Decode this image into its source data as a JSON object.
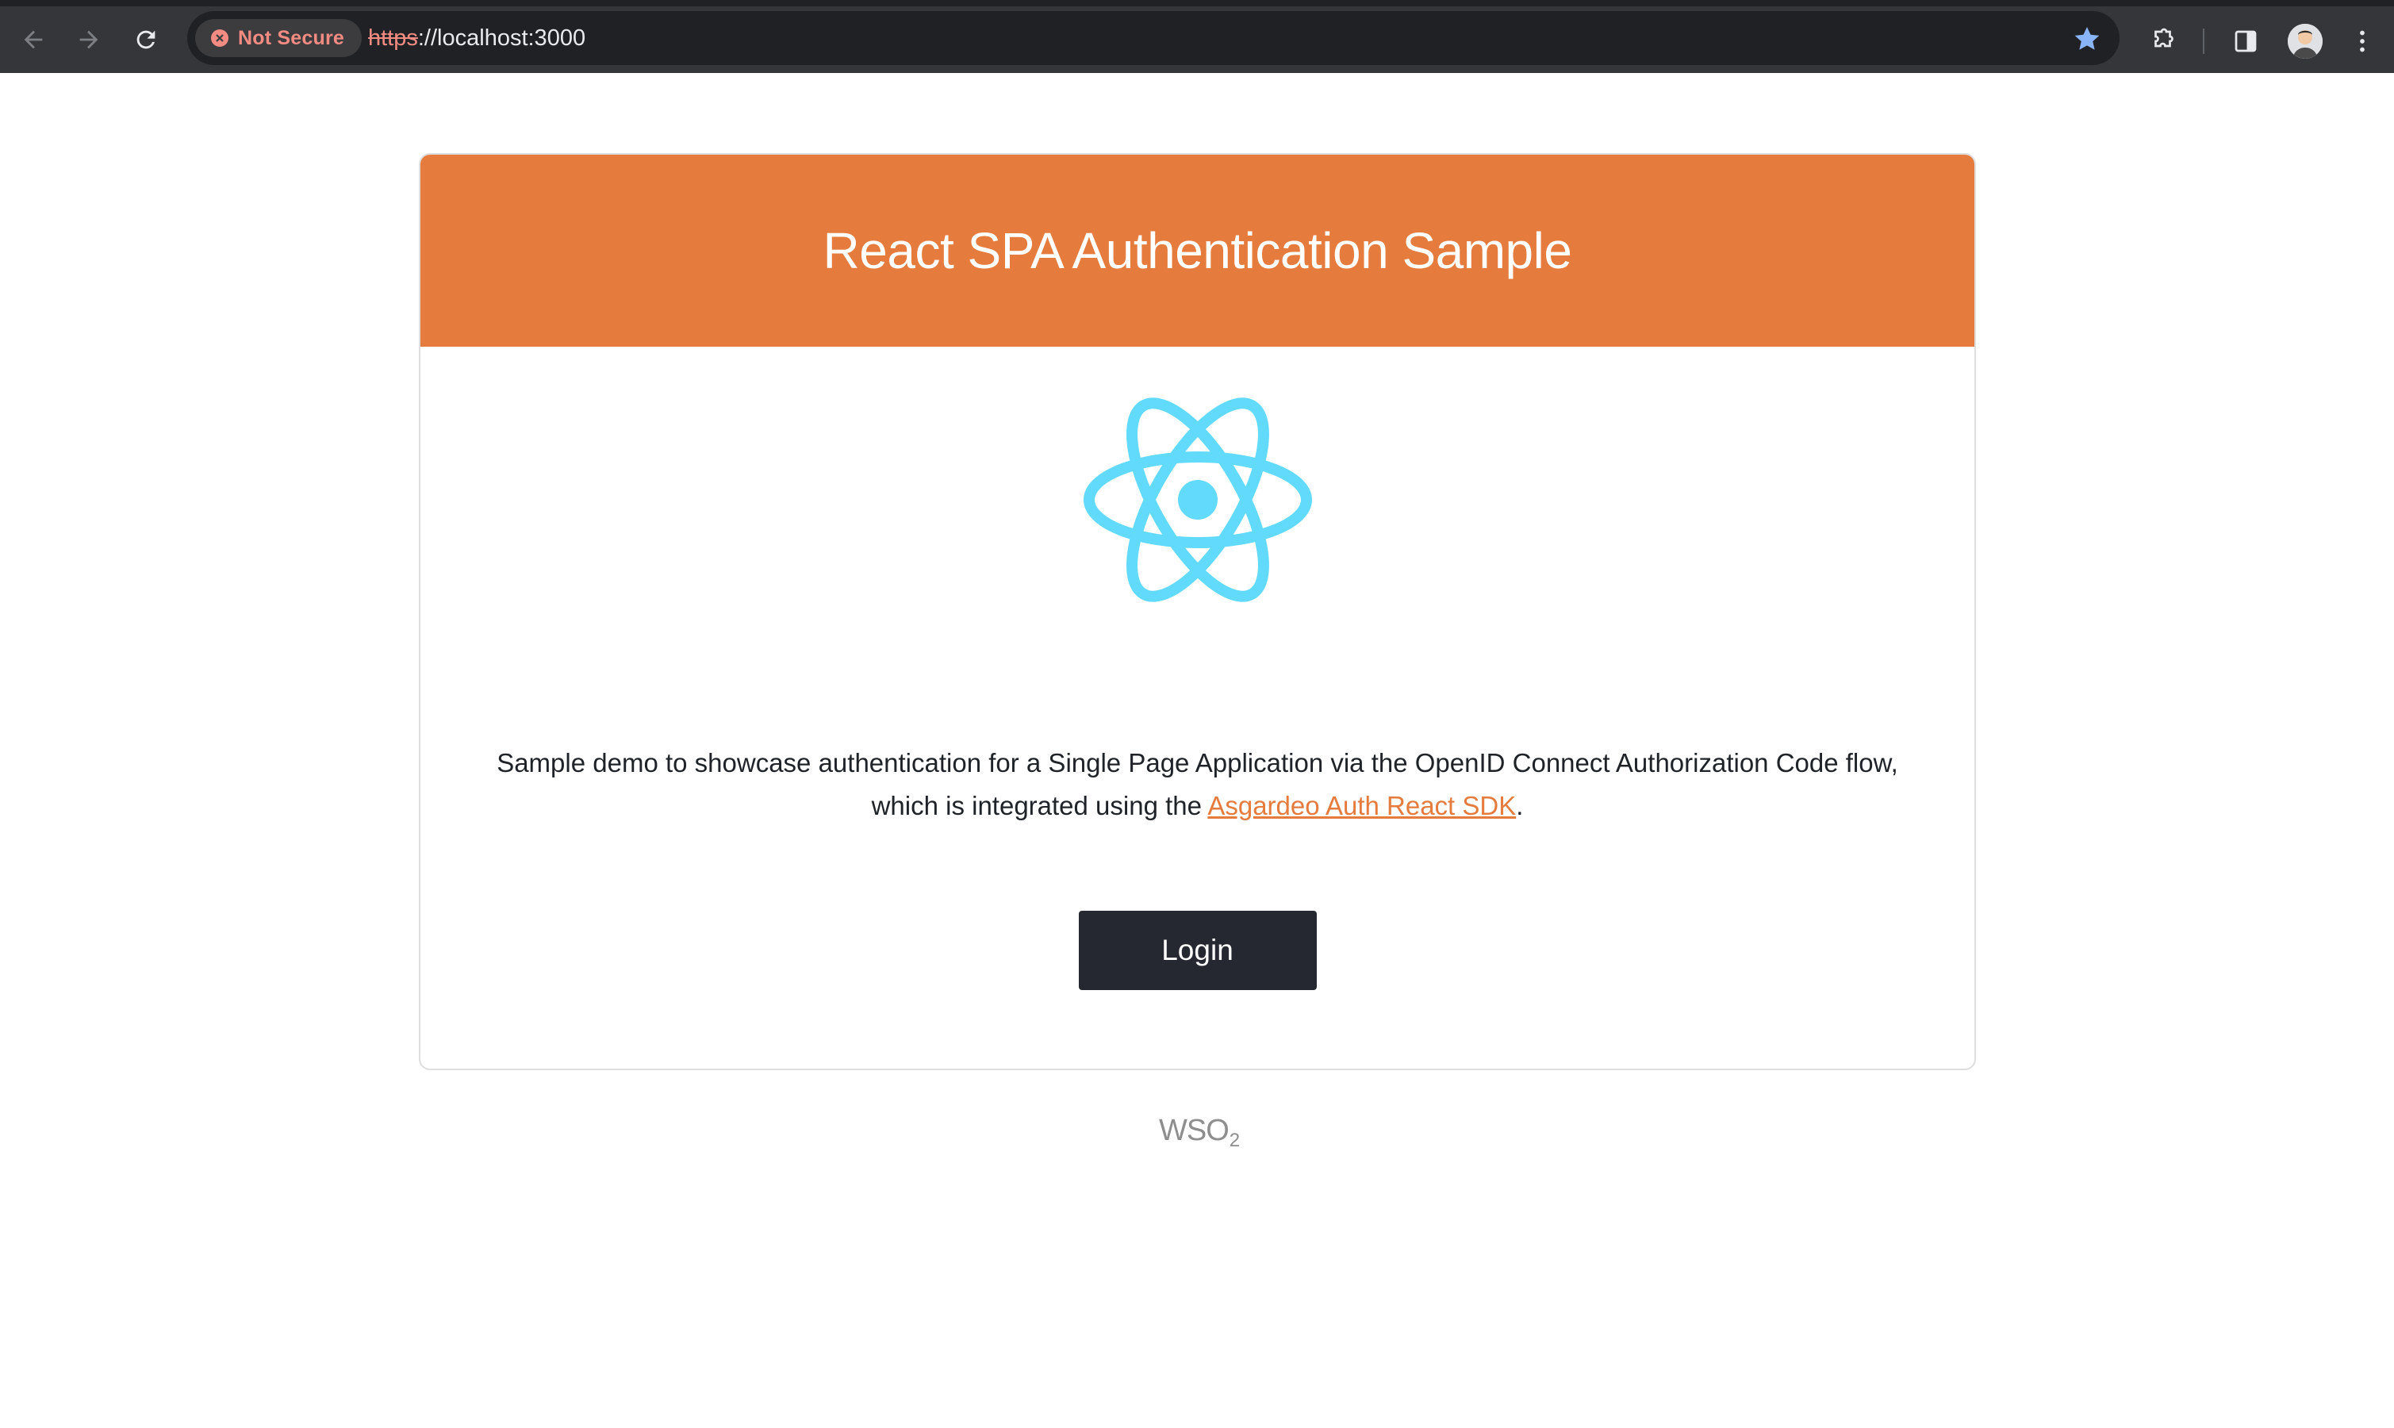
{
  "browser": {
    "security_label": "Not Secure",
    "url_scheme": "https",
    "url_rest": "://localhost:3000",
    "icons": {
      "back": "arrow-left-icon",
      "forward": "arrow-right-icon",
      "reload": "reload-icon",
      "security": "insecure-x-icon",
      "bookmark": "star-icon",
      "extensions": "puzzle-icon",
      "side_panel": "side-panel-icon",
      "profile": "avatar",
      "menu": "kebab-menu-icon"
    },
    "colors": {
      "toolbar": "#35363a",
      "omnibox": "#202124",
      "warning": "#f28b82",
      "bookmark_star": "#8ab4f8"
    }
  },
  "page": {
    "header_title": "React SPA Authentication Sample",
    "description_line1": "Sample demo to showcase authentication for a Single Page Application via the OpenID Connect Authorization Code flow,",
    "description_line2_prefix": "which is integrated using the ",
    "sdk_link_text": "Asgardeo Auth React SDK",
    "description_line2_suffix": ".",
    "login_label": "Login",
    "footer_logo_main": "WSO",
    "footer_logo_sub": "2",
    "colors": {
      "header_bg": "#e57b3c",
      "link": "#e57b3c",
      "button_bg": "#252830",
      "react_logo": "#61dafb"
    }
  }
}
